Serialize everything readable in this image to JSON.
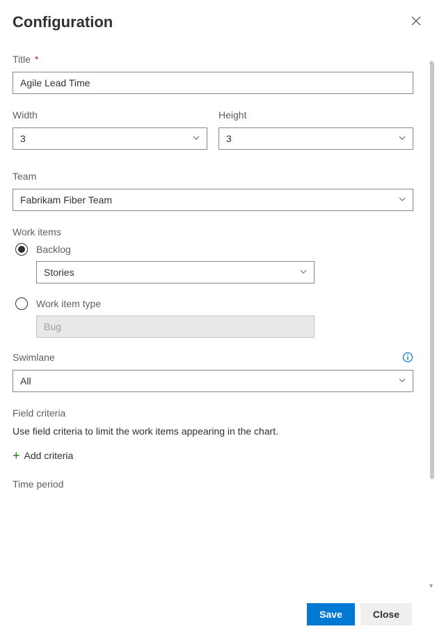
{
  "header": {
    "title": "Configuration"
  },
  "fields": {
    "title": {
      "label": "Title",
      "value": "Agile Lead Time",
      "required": "*"
    },
    "width": {
      "label": "Width",
      "value": "3"
    },
    "height": {
      "label": "Height",
      "value": "3"
    },
    "team": {
      "label": "Team",
      "value": "Fabrikam Fiber Team"
    },
    "workItems": {
      "label": "Work items",
      "backlog": {
        "label": "Backlog",
        "value": "Stories"
      },
      "workItemType": {
        "label": "Work item type",
        "value": "Bug"
      }
    },
    "swimlane": {
      "label": "Swimlane",
      "value": "All"
    },
    "fieldCriteria": {
      "label": "Field criteria",
      "help": "Use field criteria to limit the work items appearing in the chart.",
      "addLabel": "Add criteria"
    },
    "timePeriod": {
      "label": "Time period"
    }
  },
  "footer": {
    "save": "Save",
    "close": "Close"
  }
}
